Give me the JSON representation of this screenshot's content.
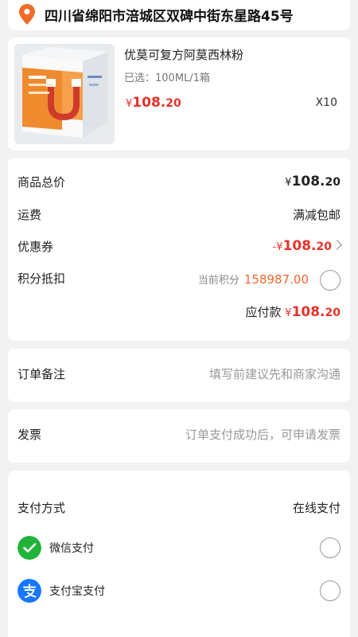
{
  "address": {
    "text": "四川省绵阳市涪城区双碑中街东星路45号",
    "icon": "location-pin-icon"
  },
  "product": {
    "name": "优莫可复方阿莫西林粉",
    "spec": "已选：100ML/1箱",
    "price_currency": "¥",
    "price_int": "108.",
    "price_dec": "20",
    "quantity": "X10",
    "image_brand": "UNIVO 优力诺",
    "image_title": "优莫克",
    "image_sub": "复方阿莫西林粉"
  },
  "summary": {
    "total_label": "商品总价",
    "total_currency": "¥",
    "total_int": "108.",
    "total_dec": "20",
    "shipping_label": "运费",
    "shipping_value": "满减包邮",
    "coupon_label": "优惠券",
    "coupon_prefix": "-",
    "coupon_currency": "¥",
    "coupon_int": "108.",
    "coupon_dec": "20",
    "points_label": "积分抵扣",
    "points_hint": "当前积分",
    "points_value": "158987.00",
    "payable_label": "应付款",
    "payable_currency": "¥",
    "payable_int": "108.",
    "payable_dec": "20"
  },
  "remark": {
    "label": "订单备注",
    "placeholder": "填写前建议先和商家沟通"
  },
  "invoice": {
    "label": "发票",
    "hint": "订单支付成功后，可申请发票"
  },
  "payment": {
    "label": "支付方式",
    "value": "在线支付",
    "methods": [
      {
        "name": "微信支付",
        "icon": "wechat-pay-icon",
        "color": "#21b339"
      },
      {
        "name": "支付宝支付",
        "icon": "alipay-icon",
        "color": "#1677ff"
      }
    ]
  },
  "colors": {
    "price_red": "#e8322a",
    "points_orange": "#f0662e",
    "pin_orange": "#f26b2a"
  }
}
